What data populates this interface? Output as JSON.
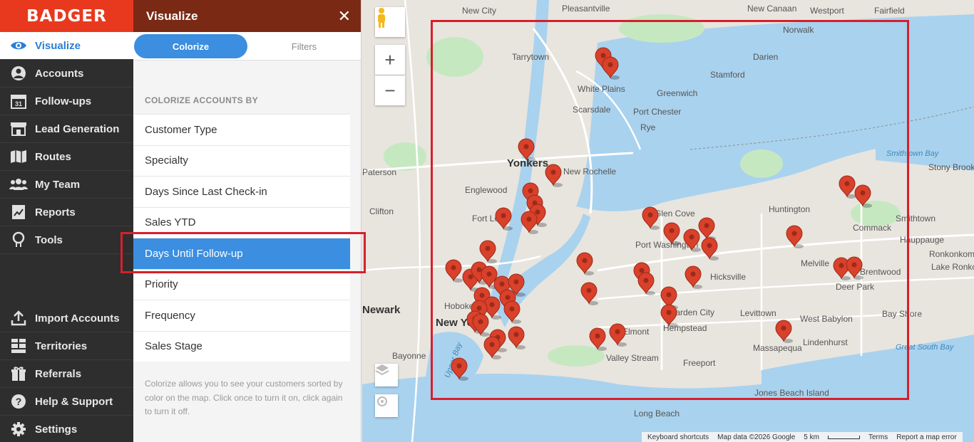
{
  "brand": "BADGER",
  "nav": {
    "items": [
      {
        "label": "Visualize",
        "icon": "eye-icon"
      },
      {
        "label": "Accounts",
        "icon": "person-icon"
      },
      {
        "label": "Follow-ups",
        "icon": "calendar-icon"
      },
      {
        "label": "Lead Generation",
        "icon": "storefront-icon"
      },
      {
        "label": "Routes",
        "icon": "route-map-icon"
      },
      {
        "label": "My Team",
        "icon": "team-icon"
      },
      {
        "label": "Reports",
        "icon": "report-icon"
      },
      {
        "label": "Tools",
        "icon": "lightbulb-icon"
      }
    ],
    "bottom_items": [
      {
        "label": "Import Accounts",
        "icon": "upload-icon"
      },
      {
        "label": "Territories",
        "icon": "territory-icon"
      },
      {
        "label": "Referrals",
        "icon": "gift-icon"
      },
      {
        "label": "Help & Support",
        "icon": "help-icon"
      },
      {
        "label": "Settings",
        "icon": "gear-icon"
      }
    ],
    "active_index": 0
  },
  "panel": {
    "title": "Visualize",
    "tabs": {
      "active": "Colorize",
      "inactive": "Filters"
    },
    "section_heading": "COLORIZE ACCOUNTS BY",
    "options": [
      "Customer Type",
      "Specialty",
      "Days Since Last Check-in",
      "Sales YTD",
      "Days Until Follow-up",
      "Priority",
      "Frequency",
      "Sales Stage"
    ],
    "selected_option": "Days Until Follow-up",
    "help_text": "Colorize allows you to see your customers sorted by color on the map. Click once to turn it on, click again to turn it off."
  },
  "map": {
    "labels": [
      "New City",
      "Pleasantville",
      "New Canaan",
      "Westport",
      "Fairfield",
      "Norwalk",
      "Tarrytown",
      "Darien",
      "Stamford",
      "White Plains",
      "Greenwich",
      "Scarsdale",
      "Port Chester",
      "Rye",
      "Yonkers",
      "New Rochelle",
      "Paterson",
      "Englewood",
      "Clifton",
      "Fort Lee",
      "Glen Cove",
      "Port Washington",
      "Huntington",
      "Commack",
      "Smithtown",
      "Hauppauge",
      "Ronkonkoma",
      "Lake Ronkonkoma",
      "Melville",
      "Deer Park",
      "Brentwood",
      "Hicksville",
      "Garden City",
      "Levittown",
      "Hempstead",
      "West Babylon",
      "Bay Shore",
      "Massapequa",
      "Lindenhurst",
      "Elmont",
      "Valley Stream",
      "Freeport",
      "Hoboken",
      "Newark",
      "New York",
      "Bayonne",
      "Long Beach",
      "Jones Beach Island",
      "Upper Bay",
      "Smithtown Bay",
      "Stony Brook",
      "Great South Bay"
    ],
    "attribution": {
      "shortcuts": "Keyboard shortcuts",
      "data": "Map data ©2026 Google",
      "scale": "5 km",
      "terms": "Terms",
      "report": "Report a map error"
    },
    "pin_color": "#d9412b",
    "accent": "#3b8ee0"
  }
}
